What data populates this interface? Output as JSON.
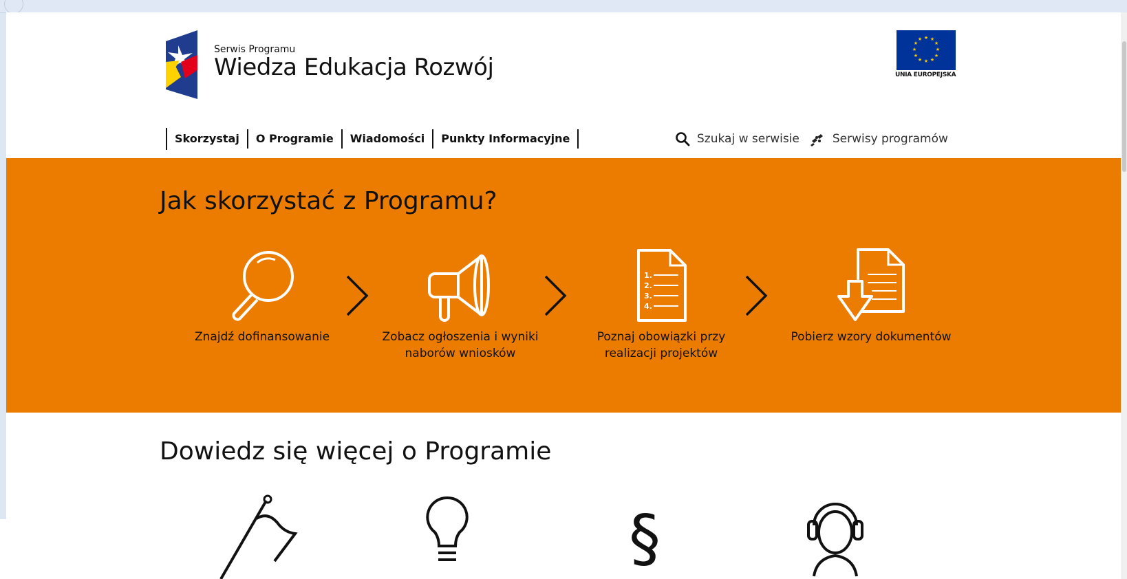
{
  "header": {
    "logo_subtitle": "Serwis Programu",
    "logo_title": "Wiedza Edukacja Rozwój",
    "eu_caption": "UNIA EUROPEJSKA"
  },
  "nav": {
    "items": [
      {
        "label": "Skorzystaj"
      },
      {
        "label": "O Programie"
      },
      {
        "label": "Wiadomości"
      },
      {
        "label": "Punkty Informacyjne"
      }
    ]
  },
  "tools": {
    "search_label": "Szukaj w serwisie",
    "search_icon": "search-icon",
    "programs_label": "Serwisy programów",
    "programs_icon": "puzzle-icon"
  },
  "how_to": {
    "title": "Jak skorzystać z Programu?",
    "steps": [
      {
        "label": "Znajdź dofinansowanie",
        "icon": "magnifier-icon"
      },
      {
        "label": "Zobacz ogłoszenia i wyniki naborów wniosków",
        "icon": "megaphone-icon"
      },
      {
        "label": "Poznaj obowiązki przy realizacji projektów",
        "icon": "document-list-icon"
      },
      {
        "label": "Pobierz wzory dokumentów",
        "icon": "document-download-icon"
      }
    ]
  },
  "learn_more": {
    "title": "Dowiedz się więcej o Programie",
    "icons": [
      "flag-icon",
      "lightbulb-icon",
      "paragraph-icon",
      "headset-icon"
    ]
  },
  "colors": {
    "accent": "#ec7c00",
    "eu_blue": "#003399",
    "eu_yellow": "#ffcc00"
  }
}
